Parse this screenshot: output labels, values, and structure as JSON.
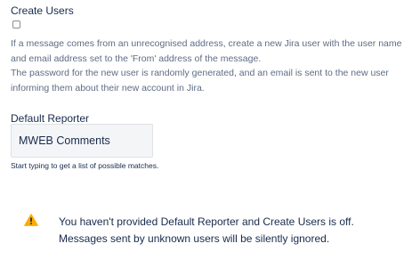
{
  "create_users": {
    "label": "Create Users",
    "checked": false,
    "description": [
      "If a message comes from an unrecognised address, create a new Jira user with the user name",
      "and email address set to the 'From' address of the message.",
      "The password for the new user is randomly generated, and an email is sent to the new user",
      "informing them about their new account in Jira."
    ]
  },
  "default_reporter": {
    "label": "Default Reporter",
    "value": "MWEB Comments",
    "hint": "Start typing to get a list of possible matches."
  },
  "warning": {
    "icon": "warning-icon",
    "lines": [
      "You haven't provided Default Reporter and Create Users is off.",
      "Messages sent by unknown users will be silently ignored."
    ]
  },
  "colors": {
    "warning_fill": "#ffab00",
    "text": "#172b4d",
    "description_text": "#5e6c84",
    "input_background": "#f4f5f7"
  }
}
